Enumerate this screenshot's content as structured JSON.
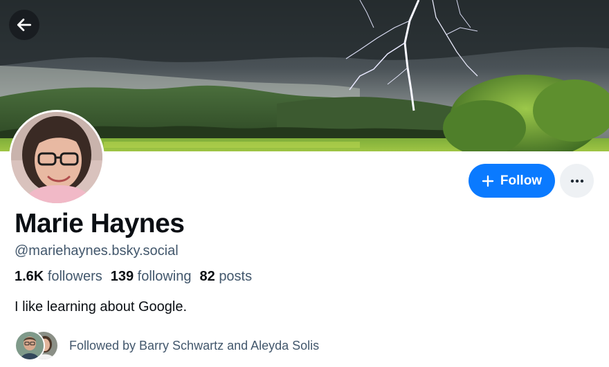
{
  "header": {
    "back_icon": "arrow-left-icon",
    "banner_description": "storm-lightning-landscape"
  },
  "profile": {
    "display_name": "Marie Haynes",
    "handle": "@mariehaynes.bsky.social",
    "bio": "I like learning about Google.",
    "stats": {
      "followers_count": "1.6K",
      "followers_label": "followers",
      "following_count": "139",
      "following_label": "following",
      "posts_count": "82",
      "posts_label": "posts"
    },
    "known_followers": "Followed by Barry Schwartz and Aleyda Solis"
  },
  "actions": {
    "follow_label": "Follow",
    "follow_icon": "plus-icon",
    "more_icon": "ellipsis-icon"
  },
  "colors": {
    "accent": "#0a7aff",
    "text_primary": "#0b0f14",
    "text_secondary": "#42576c",
    "more_button_bg": "#eef1f4"
  }
}
